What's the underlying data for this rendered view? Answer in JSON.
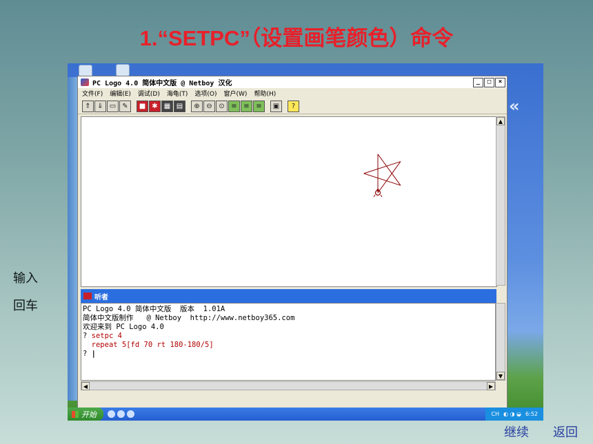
{
  "slide": {
    "title": "1.“SETPC”（设置画笔颜色）命令",
    "note_input": "输入",
    "note_enter": "回车",
    "nav_continue": "继续",
    "nav_back": "返回"
  },
  "window": {
    "title": "PC Logo 4.0 简体中文版  @ Netboy  汉化",
    "controls": [
      "_",
      "□",
      "×"
    ],
    "menu": [
      "文件(F)",
      "编辑(E)",
      "调试(D)",
      "海龟(T)",
      "选项(O)",
      "窗户(W)",
      "帮助(H)"
    ]
  },
  "listener": {
    "title": "听者",
    "lines": [
      "PC Logo 4.0 简体中文版  版本  1.01A",
      "简体中文版制作   @ Netboy  http://www.netboy365.com",
      "",
      "欢迎来到 PC Logo 4.0",
      ""
    ],
    "prompt": "?",
    "commands": [
      "setpc 4",
      "repeat 5[fd 70 rt 180-180/5]"
    ],
    "cursor": "|"
  },
  "taskbar": {
    "start_label": "开始",
    "tray_text": "CH",
    "clock": "6:52"
  },
  "colors": {
    "title_red": "#e8202a",
    "nav_blue": "#2a3fa0",
    "pen_color": "#8b0000",
    "listener_bar": "#2b6ee0"
  }
}
